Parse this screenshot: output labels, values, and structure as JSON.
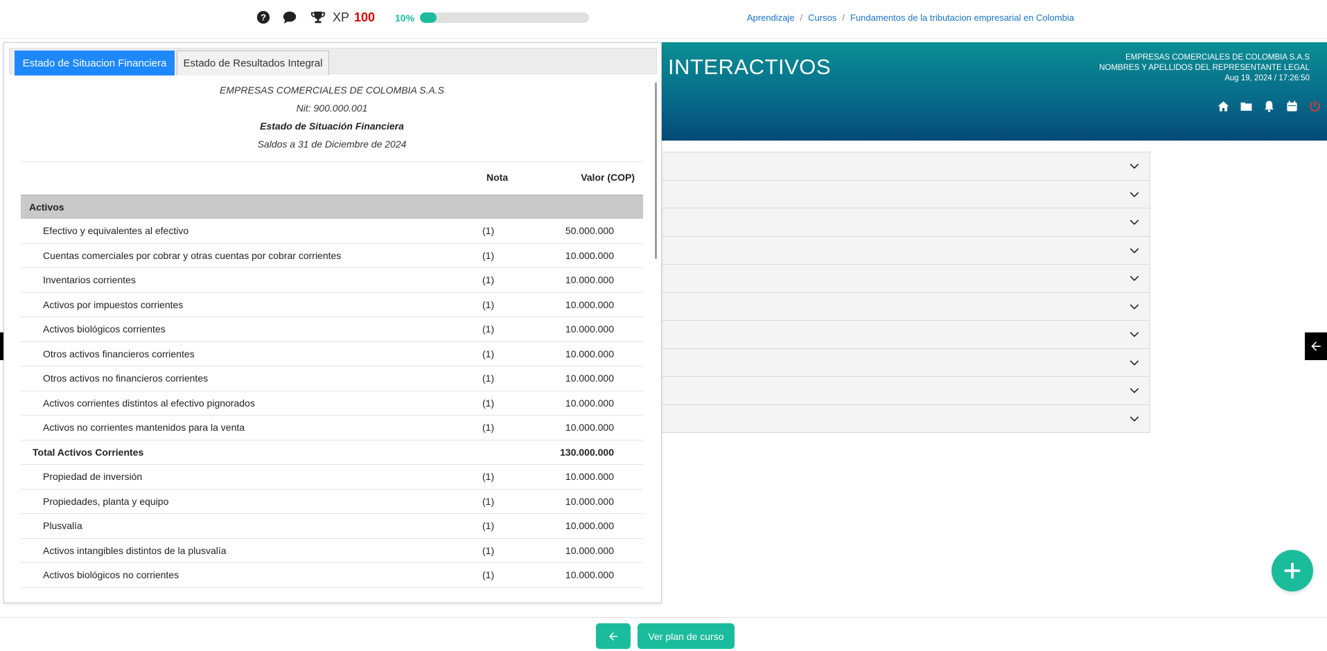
{
  "topbar": {
    "icons": [
      "help-icon",
      "chat-icon",
      "trophy-icon"
    ],
    "xp_label": "XP",
    "xp_value": "100",
    "progress_label": "10%",
    "progress_fraction": 0.1,
    "breadcrumb": [
      "Aprendizaje",
      "Cursos",
      "Fundamentos de la tributacion empresarial en Colombia"
    ]
  },
  "header": {
    "title_partial": "INTERACTIVOS",
    "company": "EMPRESAS COMERCIALES DE COLOMBIA S.A.S",
    "representative": "NOMBRES Y APELLIDOS DEL REPRESENTANTE LEGAL",
    "datetime": "Aug 19, 2024 / 17:26:50",
    "icons": [
      "home-icon",
      "folder-icon",
      "bell-icon",
      "calendar-icon",
      "power-icon"
    ],
    "gradient_colors": [
      "#0b8f94",
      "#054a78"
    ]
  },
  "accordion_rows": 10,
  "panel": {
    "tabs": [
      {
        "label": "Estado de Situacion Financiera",
        "active": true
      },
      {
        "label": "Estado de Resultados Integral",
        "active": false
      }
    ],
    "report": {
      "company": "EMPRESAS COMERCIALES DE COLOMBIA S.A.S",
      "nit": "Nit: 900.000.001",
      "title": "Estado de Situación Financiera",
      "period": "Saldos a 31 de Diciembre de 2024"
    },
    "columns": {
      "nota": "Nota",
      "valor": "Valor (COP)"
    },
    "section": "Activos",
    "rows": [
      {
        "label": "Efectivo y equivalentes al efectivo",
        "nota": "(1)",
        "valor": "50.000.000"
      },
      {
        "label": "Cuentas comerciales por cobrar y otras cuentas por cobrar corrientes",
        "nota": "(1)",
        "valor": "10.000.000"
      },
      {
        "label": "Inventarios corrientes",
        "nota": "(1)",
        "valor": "10.000.000"
      },
      {
        "label": "Activos por impuestos corrientes",
        "nota": "(1)",
        "valor": "10.000.000"
      },
      {
        "label": "Activos biológicos corrientes",
        "nota": "(1)",
        "valor": "10.000.000"
      },
      {
        "label": "Otros activos financieros corrientes",
        "nota": "(1)",
        "valor": "10.000.000"
      },
      {
        "label": "Otros activos no financieros corrientes",
        "nota": "(1)",
        "valor": "10.000.000"
      },
      {
        "label": "Activos corrientes distintos al efectivo pignorados",
        "nota": "(1)",
        "valor": "10.000.000"
      },
      {
        "label": "Activos no corrientes mantenidos para la venta",
        "nota": "(1)",
        "valor": "10.000.000"
      },
      {
        "label": "Total Activos Corrientes",
        "nota": "",
        "valor": "130.000.000",
        "total": true
      },
      {
        "label": "Propiedad de inversión",
        "nota": "(1)",
        "valor": "10.000.000"
      },
      {
        "label": "Propiedades, planta y equipo",
        "nota": "(1)",
        "valor": "10.000.000"
      },
      {
        "label": "Plusvalía",
        "nota": "(1)",
        "valor": "10.000.000"
      },
      {
        "label": "Activos intangibles distintos de la plusvalía",
        "nota": "(1)",
        "valor": "10.000.000"
      },
      {
        "label": "Activos biológicos no corrientes",
        "nota": "(1)",
        "valor": "10.000.000"
      }
    ]
  },
  "footer": {
    "back_icon": "arrow-left-icon",
    "plan_label": "Ver plan de curso"
  },
  "accent_color": "#1abc9c",
  "tab_active_color": "#1e88ff"
}
